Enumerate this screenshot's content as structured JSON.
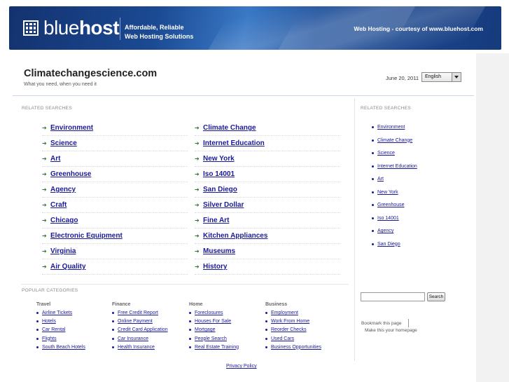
{
  "banner": {
    "logo_light": "blue",
    "logo_bold": "host",
    "tagline_line1": "Affordable, Reliable",
    "tagline_line2": "Web Hosting Solutions",
    "courtesy": "Web Hosting - courtesy of www.bluehost.com",
    "colors": {
      "dark": "#13326f",
      "mid": "#1b4a93",
      "light": "#3a79c6"
    }
  },
  "header": {
    "title": "Climatechangescience.com",
    "subtitle": "What you need, when you need it",
    "date": "June 20, 2011",
    "language": "English"
  },
  "related": {
    "label": "RELATED SEARCHES",
    "left_col": [
      "Environment",
      "Science",
      "Art",
      "Greenhouse",
      "Agency",
      "Craft",
      "Chicago",
      "Electronic Equipment",
      "Virginia",
      "Air Quality"
    ],
    "right_col": [
      "Climate Change",
      "Internet Education",
      "New York",
      "Iso 14001",
      "San Diego",
      "Silver Dollar",
      "Fine Art",
      "Kitchen Appliances",
      "Museums",
      "History"
    ]
  },
  "sidebar": {
    "label": "RELATED SEARCHES",
    "items": [
      "Environment",
      "Climate Change",
      "Science",
      "Internet Education",
      "Art",
      "New York",
      "Greenhouse",
      "Iso 14001",
      "Agency",
      "San Diego"
    ],
    "search_button": "Search",
    "bookmark": "Bookmark this page",
    "homepage": "Make this your homepage"
  },
  "popular": {
    "label": "POPULAR CATEGORIES",
    "columns": [
      {
        "heading": "Travel",
        "items": [
          "Airline Tickets",
          "Hotels",
          "Car Rental",
          "Flights",
          "South Beach Hotels"
        ]
      },
      {
        "heading": "Finance",
        "items": [
          "Free Credit Report",
          "Online Payment",
          "Credit Card Application",
          "Car Insurance",
          "Health Insurance"
        ]
      },
      {
        "heading": "Home",
        "items": [
          "Foreclosures",
          "Houses For Sale",
          "Mortgage",
          "People Search",
          "Real Estate Training"
        ]
      },
      {
        "heading": "Business",
        "items": [
          "Employment",
          "Work From Home",
          "Reorder Checks",
          "Used Cars",
          "Business Opportunities"
        ]
      }
    ]
  },
  "footer": {
    "privacy": "Privacy Policy"
  },
  "colors": {
    "link": "#1a1a99",
    "arrow": "#2a6f2a"
  }
}
